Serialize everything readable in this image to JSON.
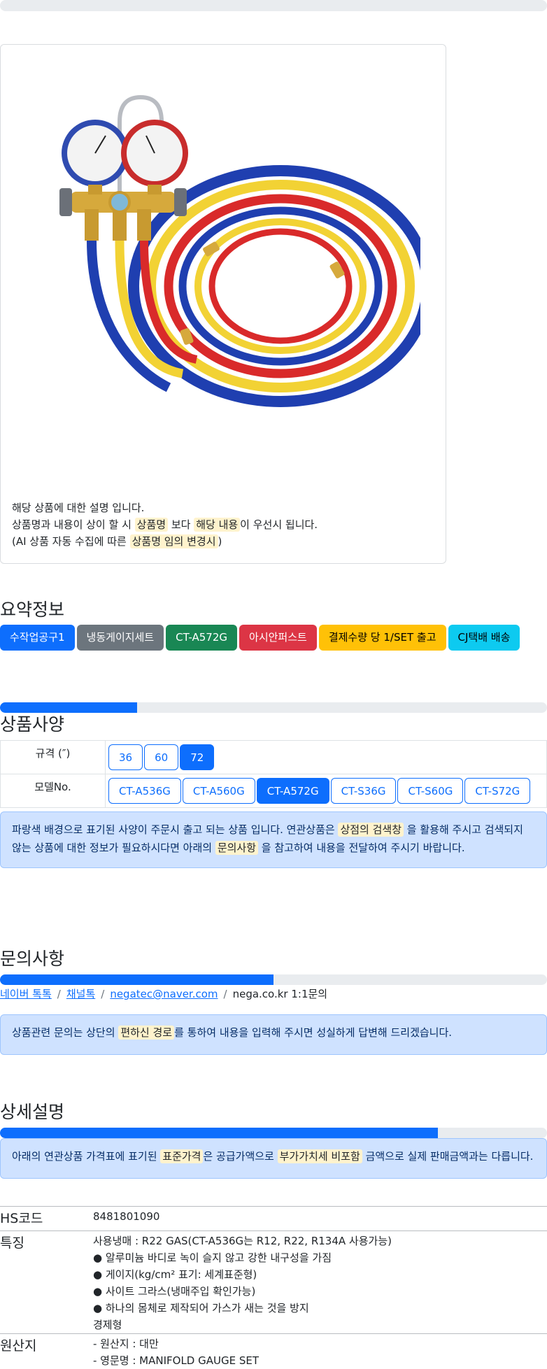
{
  "product_card": {
    "desc_line1": "해당 상품에 대한 설명 입니다.",
    "desc_line2_a": "상품명과 내용이 상이 할 시 ",
    "desc_line2_b": "상품명",
    "desc_line2_c": " 보다 ",
    "desc_line2_d": "해당 내용",
    "desc_line2_e": "이 우선시 됩니다.",
    "desc_line3_a": "(AI 상품 자동 수집에 따른 ",
    "desc_line3_b": "상품명 임의 변경시",
    "desc_line3_c": ")"
  },
  "summary": {
    "title": "요약정보",
    "badges": [
      {
        "label": "수작업공구1",
        "color": "#0d6efd",
        "text": "#ffffff"
      },
      {
        "label": "냉동게이지세트",
        "color": "#6c757d",
        "text": "#ffffff"
      },
      {
        "label": "CT-A572G",
        "color": "#198754",
        "text": "#ffffff"
      },
      {
        "label": "아시안퍼스트",
        "color": "#dc3545",
        "text": "#ffffff"
      },
      {
        "label": "결제수량 당 1/SET 출고",
        "color": "#ffc107",
        "text": "#000000"
      },
      {
        "label": "CJ택배 배송",
        "color": "#0dcaf0",
        "text": "#000000"
      }
    ]
  },
  "spec": {
    "title": "상품사양",
    "progress": 0.25,
    "size_label": "규격 (″)",
    "sizes": [
      "36",
      "60",
      "72"
    ],
    "size_selected": "72",
    "model_label": "모델No.",
    "models": [
      "CT-A536G",
      "CT-A560G",
      "CT-A572G",
      "CT-S36G",
      "CT-S60G",
      "CT-S72G"
    ],
    "model_selected": "CT-A572G",
    "notice_a": "파랑색 배경으로 표기된 사양이 주문시 출고 되는 상품 입니다. 연관상품은 ",
    "notice_b": "상점의 검색창",
    "notice_c": " 을 활용해 주시고 검색되지 않는 상품에 대한 정보가 필요하시다면 아래의 ",
    "notice_d": "문의사항",
    "notice_e": " 을 참고하여 내용을 전달하여 주시기 바랍니다."
  },
  "inquiry": {
    "title": "문의사항",
    "progress": 0.5,
    "link1": "네이버 톡톡",
    "link2": "채널톡",
    "link3": "negatec@naver.com",
    "text4": "nega.co.kr 1:1문의",
    "notice_a": "상품관련 문의는 상단의 ",
    "notice_b": "편하신 경로",
    "notice_c": "를 통하여 내용을 입력해 주시면 성실하게 답변해 드리겠습니다."
  },
  "detail": {
    "title": "상세설명",
    "progress": 0.8,
    "notice_a": "아래의 연관상품 가격표에 표기된 ",
    "notice_b": "표준가격",
    "notice_c": "은 공급가액으로 ",
    "notice_d": "부가가치세 비포함",
    "notice_e": " 금액으로 실제 판매금액과는 다릅니다."
  },
  "info": {
    "hs_label": "HS코드",
    "hs_value": "8481801090",
    "feature_label": "특징",
    "features": [
      "사용냉매 : R22 GAS(CT-A536G는 R12, R22, R134A 사용가능)",
      "● 알루미늄 바디로 녹이 슬지 않고 강한 내구성을 가짐",
      "● 게이지(kg/cm² 표기: 세계표준형)",
      "● 사이트 그라스(냉매주입 확인가능)",
      "● 하나의 몸체로 제작되어 가스가 새는 것을 방지",
      "경제형"
    ],
    "origin_label": "원산지",
    "origins": [
      "- 원산지 : 대만",
      "- 영문명 : MANIFOLD GAUGE SET"
    ]
  }
}
